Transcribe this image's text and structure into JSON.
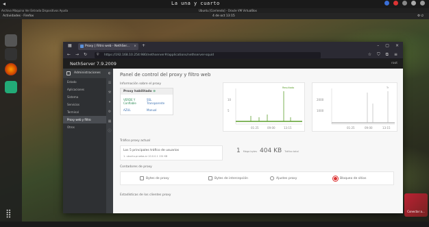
{
  "desktop": {
    "title": "La una y cuarto",
    "menu_text": "Actividades",
    "app_menu": "Firefox",
    "subbar_left": "Archivo  Máquina  Ver  Entrada  Dispositivos  Ayuda",
    "subbar_center": "Ubuntu [Corriendo] - Oracle VM VirtualBox",
    "clock_short": "4 de oct  13:15"
  },
  "browser": {
    "tab_label": "Proxy | Filtro web - NethSer...",
    "url": "https://192.168.10.254:980/nethserver#/applications/nethserver-squid"
  },
  "app": {
    "brand": "NethServer 7.9.2009",
    "user_menu": "root",
    "sidebar_top": "Administraciones",
    "sidebar_items": [
      "Estado",
      "Aplicaciones",
      "Sistema",
      "Servicios",
      "Terminal",
      "Proxy web y filtro",
      "Otros"
    ],
    "page_title": "Panel de control del proxy y filtro web",
    "proxy_info_label": "Información sobre el proxy",
    "proxy_enabled": "Proxy habilitado",
    "proxy_modes": [
      "VERDE Y Confiable",
      "SSL Transparente",
      "AZUL",
      "Manual"
    ],
    "traffic_label": "Tráfico proxy actual",
    "traffic_card_title": "Los 5 principales tráfico de usuarios",
    "traffic_card_sub": "1. ubuntu.prueba.ar 10.0.0.1  134 KB",
    "summary_value": "1",
    "summary_unit": "Mega bytes",
    "summary_mb": "404 KB",
    "summary_label": "Tráfico total",
    "counters_label": "Contadores de proxy",
    "counters": [
      "Bytes de proxy",
      "Bytes de intercepción",
      "Ajustes proxy",
      "Bloqueo de sitios"
    ],
    "stats_label": "Estadísticas de los clientes proxy",
    "chart1": {
      "xticks": [
        "01:25",
        "09:00",
        "13:15"
      ],
      "yticks": [
        "10",
        "5"
      ],
      "legend": "Resultado"
    },
    "chart2": {
      "xticks": [
        "01:25",
        "09:00",
        "13:15"
      ],
      "yticks": [
        "2000",
        "1000"
      ],
      "legend": "Tr"
    }
  },
  "corner": {
    "label": "Conectar a..."
  }
}
